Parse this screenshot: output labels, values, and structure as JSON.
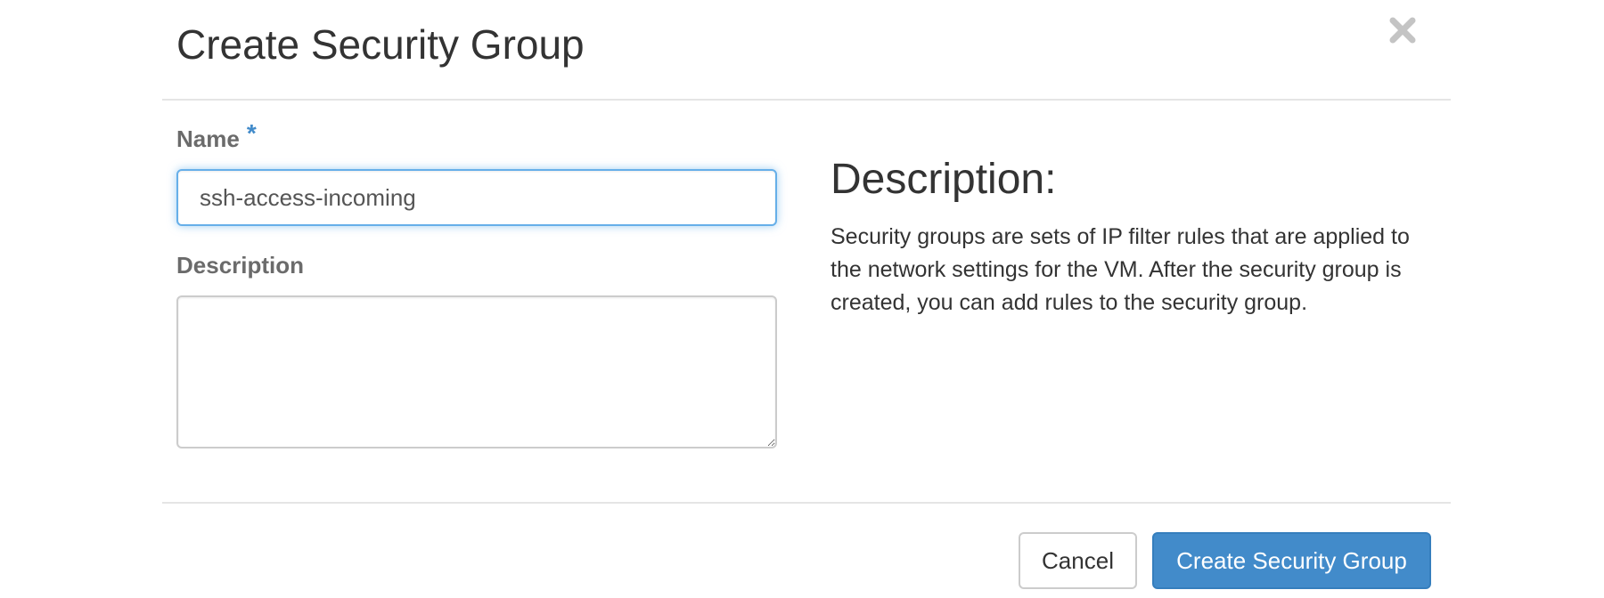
{
  "modal": {
    "title": "Create Security Group",
    "close_icon": "close-icon"
  },
  "form": {
    "name_label": "Name",
    "required_marker": "*",
    "name_value": "ssh-access-incoming",
    "description_label": "Description",
    "description_value": ""
  },
  "help": {
    "heading": "Description:",
    "text": "Security groups are sets of IP filter rules that are applied to the network settings for the VM. After the security group is created, you can add rules to the security group."
  },
  "footer": {
    "cancel_label": "Cancel",
    "submit_label": "Create Security Group"
  },
  "colors": {
    "accent": "#428bca",
    "focus_border": "#66afe9",
    "label_text": "#6b6b6b"
  }
}
